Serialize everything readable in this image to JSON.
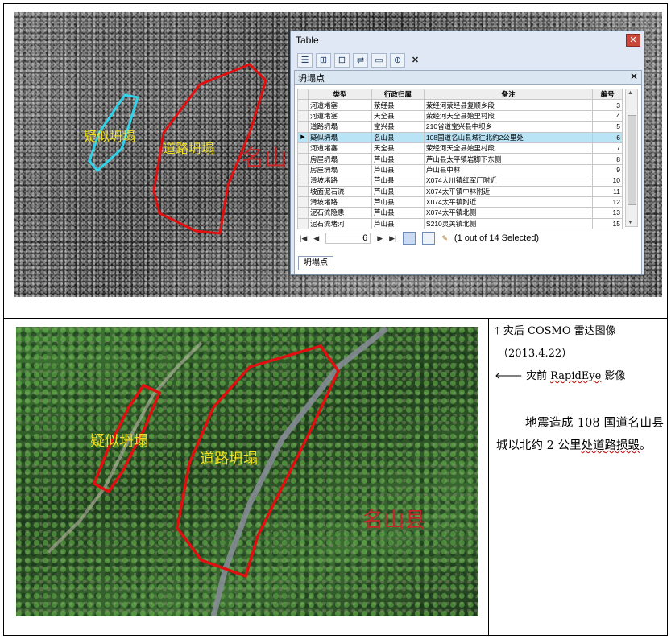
{
  "top_image": {
    "labels": {
      "suspected_collapse": "疑似坍塌",
      "road_collapse": "道路坍塌",
      "county": "名山"
    },
    "colors": {
      "road_outline": "#e01010",
      "suspect_outline": "#2fd2e8",
      "label": "#f0e020",
      "county": "#c0282a"
    }
  },
  "table_window": {
    "title": "Table",
    "layer": "坍塌点",
    "columns": [
      "类型",
      "行政归属",
      "备注",
      "编号"
    ],
    "rows": [
      {
        "type": "河道堵塞",
        "admin": "荥经县",
        "note": "荥经河荥经县复顺乡段",
        "id": "3",
        "current": false
      },
      {
        "type": "河道堵塞",
        "admin": "天全县",
        "note": "荥经河天全县始里村段",
        "id": "4",
        "current": false
      },
      {
        "type": "道路坍塌",
        "admin": "宝兴县",
        "note": "210省道宝兴县中坝乡",
        "id": "5",
        "current": false
      },
      {
        "type": "疑似坍塌",
        "admin": "名山县",
        "note": "108国道名山县城往北约2公里处",
        "id": "6",
        "current": true
      },
      {
        "type": "河道堵塞",
        "admin": "天全县",
        "note": "荥经河天全县始里村段",
        "id": "7",
        "current": false
      },
      {
        "type": "房屋坍塌",
        "admin": "芦山县",
        "note": "芦山县太平镇岩脚下东侧",
        "id": "8",
        "current": false
      },
      {
        "type": "房屋坍塌",
        "admin": "芦山县",
        "note": "芦山县中林",
        "id": "9",
        "current": false
      },
      {
        "type": "滑坡堵路",
        "admin": "芦山县",
        "note": "X074大川镇红军厂附近",
        "id": "10",
        "current": false
      },
      {
        "type": "坡面泥石流",
        "admin": "芦山县",
        "note": "X074太平镇中林附近",
        "id": "11",
        "current": false
      },
      {
        "type": "滑坡堵路",
        "admin": "芦山县",
        "note": "X074太平镇附近",
        "id": "12",
        "current": false
      },
      {
        "type": "泥石流隐患",
        "admin": "芦山县",
        "note": "X074太平镇北侧",
        "id": "13",
        "current": false
      },
      {
        "type": "泥石流堵河",
        "admin": "芦山县",
        "note": "S210灵关镇北侧",
        "id": "15",
        "current": false
      }
    ],
    "current_record": "6",
    "selection_status": "(1 out of 14 Selected)",
    "tab_label": "坍塌点"
  },
  "bottom_image": {
    "labels": {
      "suspected_collapse": "疑似坍塌",
      "road_collapse": "道路坍塌",
      "county": "名山县"
    }
  },
  "legend": {
    "after": "灾后 COSMO 雷达图像",
    "after_date": "（2013.4.22）",
    "before_prefix": "灾前 ",
    "before_name": "RapidEye",
    "before_suffix": " 影像"
  },
  "paragraph": {
    "text_a": "地震造成 108 国道名山县城以北约 2 公里",
    "text_b": "处道",
    "text_c": "路损毁",
    "text_d": "。"
  }
}
